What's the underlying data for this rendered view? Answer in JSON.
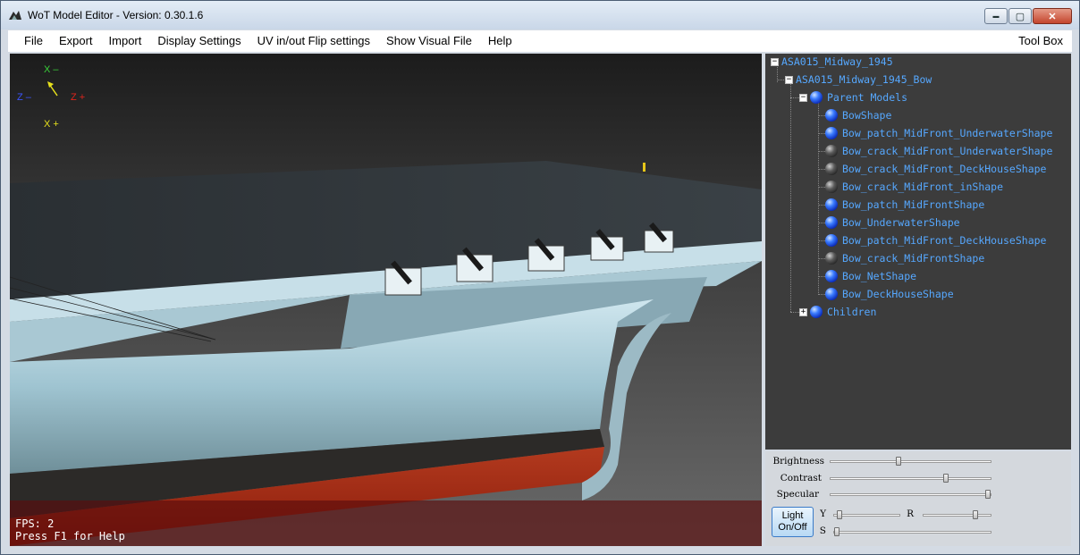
{
  "window": {
    "title": "WoT Model Editor - Version:  0.30.1.6",
    "minimize": "▬",
    "maximize": "▢",
    "close": "✕"
  },
  "menu": {
    "items": [
      "File",
      "Export",
      "Import",
      "Display Settings",
      "UV in/out Flip settings",
      "Show Visual File",
      "Help"
    ],
    "toolbox": "Tool Box"
  },
  "viewport": {
    "axes": {
      "x_minus": "X  –",
      "z_minus": "Z  –",
      "z_plus": "Z  +",
      "x_plus": "X  +"
    },
    "fps": "FPS: 2",
    "help": "Press F1 for Help"
  },
  "tree": {
    "root": "ASA015_Midway_1945",
    "child": "ASA015_Midway_1945_Bow",
    "parent_models": "Parent Models",
    "shapes": [
      {
        "label": "BowShape",
        "color": "blue"
      },
      {
        "label": "Bow_patch_MidFront_UnderwaterShape",
        "color": "blue"
      },
      {
        "label": "Bow_crack_MidFront_UnderwaterShape",
        "color": "dark"
      },
      {
        "label": "Bow_crack_MidFront_DeckHouseShape",
        "color": "dark"
      },
      {
        "label": "Bow_crack_MidFront_inShape",
        "color": "dark"
      },
      {
        "label": "Bow_patch_MidFrontShape",
        "color": "blue"
      },
      {
        "label": "Bow_UnderwaterShape",
        "color": "blue"
      },
      {
        "label": "Bow_patch_MidFront_DeckHouseShape",
        "color": "blue"
      },
      {
        "label": "Bow_crack_MidFrontShape",
        "color": "dark"
      },
      {
        "label": "Bow_NetShape",
        "color": "blue"
      },
      {
        "label": "Bow_DeckHouseShape",
        "color": "blue"
      }
    ],
    "children": "Children"
  },
  "controls": {
    "brightness_label": "Brightness",
    "brightness_value": 0.42,
    "contrast_label": "Contrast",
    "contrast_value": 0.73,
    "specular_label": "Specular",
    "specular_value": 1.0,
    "light_button": "Light\nOn/Off",
    "y_label": "Y",
    "y_value": 0.05,
    "r_label": "R",
    "r_value": 0.8,
    "s_label": "S",
    "s_value": 0.0
  }
}
